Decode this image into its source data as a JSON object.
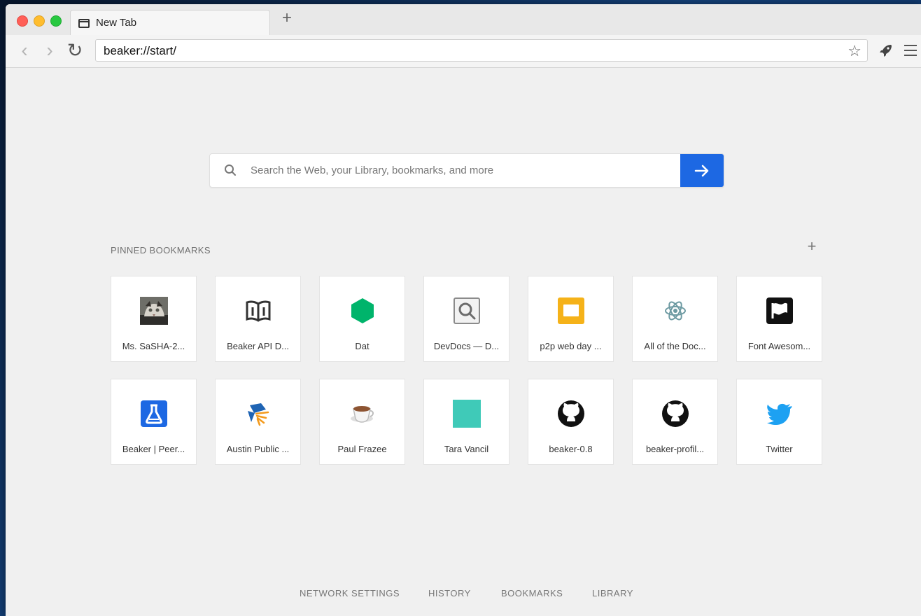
{
  "window": {
    "tab_title": "New Tab",
    "new_tab_label": "+",
    "address": "beaker://start/"
  },
  "icons": {
    "new_tab": "new-tab-icon",
    "back": "back-icon",
    "forward": "forward-icon",
    "reload": "reload-icon",
    "bookmark_star": "star-icon",
    "rocket": "rocket-icon",
    "menu": "menu-icon",
    "search": "search-icon",
    "search_go": "arrow-right-icon",
    "pinned_add": "plus-icon"
  },
  "search": {
    "placeholder": "Search the Web, your Library, bookmarks, and more"
  },
  "pinned": {
    "heading": "PINNED BOOKMARKS",
    "items": [
      {
        "label": "Ms. SaSHA-2...",
        "icon": "cat-avatar-icon"
      },
      {
        "label": "Beaker API D...",
        "icon": "book-icon"
      },
      {
        "label": "Dat",
        "icon": "green-hexagon-icon"
      },
      {
        "label": "DevDocs — D...",
        "icon": "document-search-icon"
      },
      {
        "label": "p2p web day ...",
        "icon": "slides-icon"
      },
      {
        "label": "All of the Doc...",
        "icon": "atom-icon"
      },
      {
        "label": "Font Awesom...",
        "icon": "flag-icon"
      },
      {
        "label": "Beaker | Peer...",
        "icon": "flask-icon"
      },
      {
        "label": "Austin Public ...",
        "icon": "library-icon"
      },
      {
        "label": "Paul Frazee",
        "icon": "coffee-cup-icon"
      },
      {
        "label": "Tara Vancil",
        "icon": "teal-square-icon"
      },
      {
        "label": "beaker-0.8",
        "icon": "github-icon"
      },
      {
        "label": "beaker-profil...",
        "icon": "github-icon"
      },
      {
        "label": "Twitter",
        "icon": "twitter-bird-icon"
      }
    ]
  },
  "footer": {
    "network_settings": "NETWORK SETTINGS",
    "history": "HISTORY",
    "bookmarks": "BOOKMARKS",
    "library": "LIBRARY"
  },
  "colors": {
    "primary_blue": "#1d68e3",
    "dat_green": "#00b46b",
    "slides_yellow": "#f5b219",
    "teal": "#3fcab8",
    "twitter_blue": "#1da1f2"
  }
}
